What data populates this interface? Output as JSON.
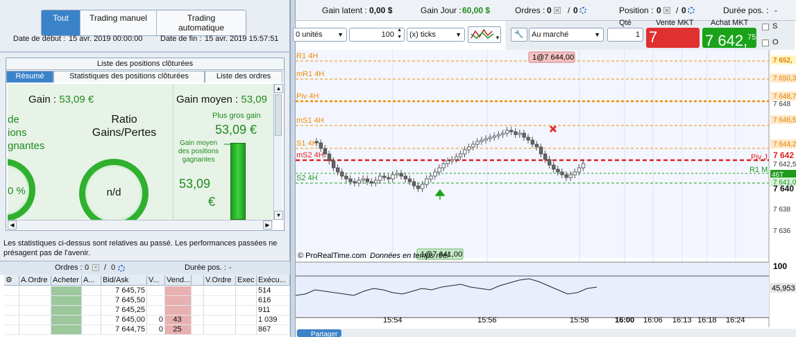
{
  "left": {
    "tabs": [
      "Tout",
      "Trading manuel",
      "Trading automatique"
    ],
    "start_date_label": "Date de début :",
    "start_date": "15 avr. 2019 00:00:00",
    "end_date_label": "Date de fin :",
    "end_date": "15 avr. 2019 15:57:51",
    "panel_title": "Liste des positions clôturées",
    "subtabs": [
      "Résumé",
      "Statistiques des positions clôturées",
      "Liste des ordres"
    ],
    "gain_label": "Gain :",
    "gain_value": "53,09 €",
    "side_frag": [
      "de",
      "ions",
      "gnantes"
    ],
    "ratio_label_1": "Ratio",
    "ratio_label_2": "Gains/Pertes",
    "ratio_value": "n/d",
    "left_ring_value": "0 %",
    "gain_moyen_label": "Gain moyen :",
    "gain_moyen_value": "53,09",
    "plus_gros_gain_label": "Plus gros gain",
    "plus_gros_gain_value": "53,09 €",
    "gain_moyen_pos_label": "Gain moyen des positions gagnantes",
    "gain_moyen_pos_value": "53,09",
    "gain_moyen_pos_unit": "€",
    "note": "Les statistiques ci-dessus sont relatives au passé. Les performances passées ne présagent pas de l'avenir.",
    "orders_label": "Ordres :",
    "orders_count": "0",
    "orders_count2": "0",
    "duree_label": "Durée pos. :",
    "duree_value": "-",
    "table_headers": [
      "A.Ordre",
      "Acheter",
      "A...",
      "Bid/Ask",
      "V...",
      "Vend...",
      "",
      "V.Ordre",
      "Exec",
      "Exécu..."
    ],
    "table_rows": [
      {
        "bidask": "7 645,75",
        "v": "",
        "vend": "",
        "exec": "514"
      },
      {
        "bidask": "7 645,50",
        "v": "",
        "vend": "",
        "exec": "616"
      },
      {
        "bidask": "7 645,25",
        "v": "",
        "vend": "",
        "exec": "911"
      },
      {
        "bidask": "7 645,00",
        "v": "0",
        "vend": "43",
        "exec": "1 039"
      },
      {
        "bidask": "7 644,75",
        "v": "0",
        "vend": "25",
        "exec": "867"
      }
    ]
  },
  "top": {
    "gain_latent_label": "Gain latent :",
    "gain_latent_value": "0,00 $",
    "gain_jour_label": "Gain Jour :",
    "gain_jour_value": "60,00 $",
    "ordres_label": "Ordres :",
    "ordres_value": "0",
    "ordres_value2": "0",
    "position_label": "Position :",
    "position_value": "0",
    "position_value2": "0",
    "duree_label": "Durée pos. :",
    "duree_value": "-",
    "units": "0 unités",
    "qty": "100",
    "ticks": "(x) ticks",
    "order_type": "Au marché",
    "qte_label": "Qté",
    "qte_value": "1",
    "vente_label": "Vente MKT",
    "vente_price": "7 642,",
    "vente_dec": "50",
    "achat_label": "Achat MKT",
    "achat_price": "7 642,",
    "achat_dec": "75",
    "s_label": "S",
    "o_label": "O"
  },
  "chart_data": {
    "type": "candlestick",
    "pivot_labels": [
      "R1 4H",
      "mR1 4H",
      "Piv 4H",
      "mS1 4H",
      "S1 4H",
      "mS2 4H",
      "S2 4H"
    ],
    "right_labels": [
      "Piv J",
      "R1 M"
    ],
    "price_ticks": [
      "7 652,",
      "7 650,3",
      "7 648,7",
      "7 648",
      "7 646,5",
      "7 644,2",
      "7 642",
      "7 642,5",
      "46T",
      "7 641,0",
      "7 640",
      "7 638",
      "7 636"
    ],
    "tag_top": "1@7 644,00",
    "tag_bottom": "1@7 641,00",
    "attribution": "© ProRealTime.com",
    "attribution2": "Données en temps réel",
    "time_ticks": [
      "15:54",
      "15:56",
      "15:58",
      "16:00",
      "16:06",
      "16:13",
      "16:18",
      "16:24"
    ],
    "indicator_top": "100",
    "indicator_value": "45,953",
    "share_label": "Partager",
    "colors": {
      "pivot": "#f08c00",
      "piv_j": "#e02020",
      "support": "#1f9a1f",
      "sell": "#e03030",
      "buy": "#1aa31a"
    }
  }
}
